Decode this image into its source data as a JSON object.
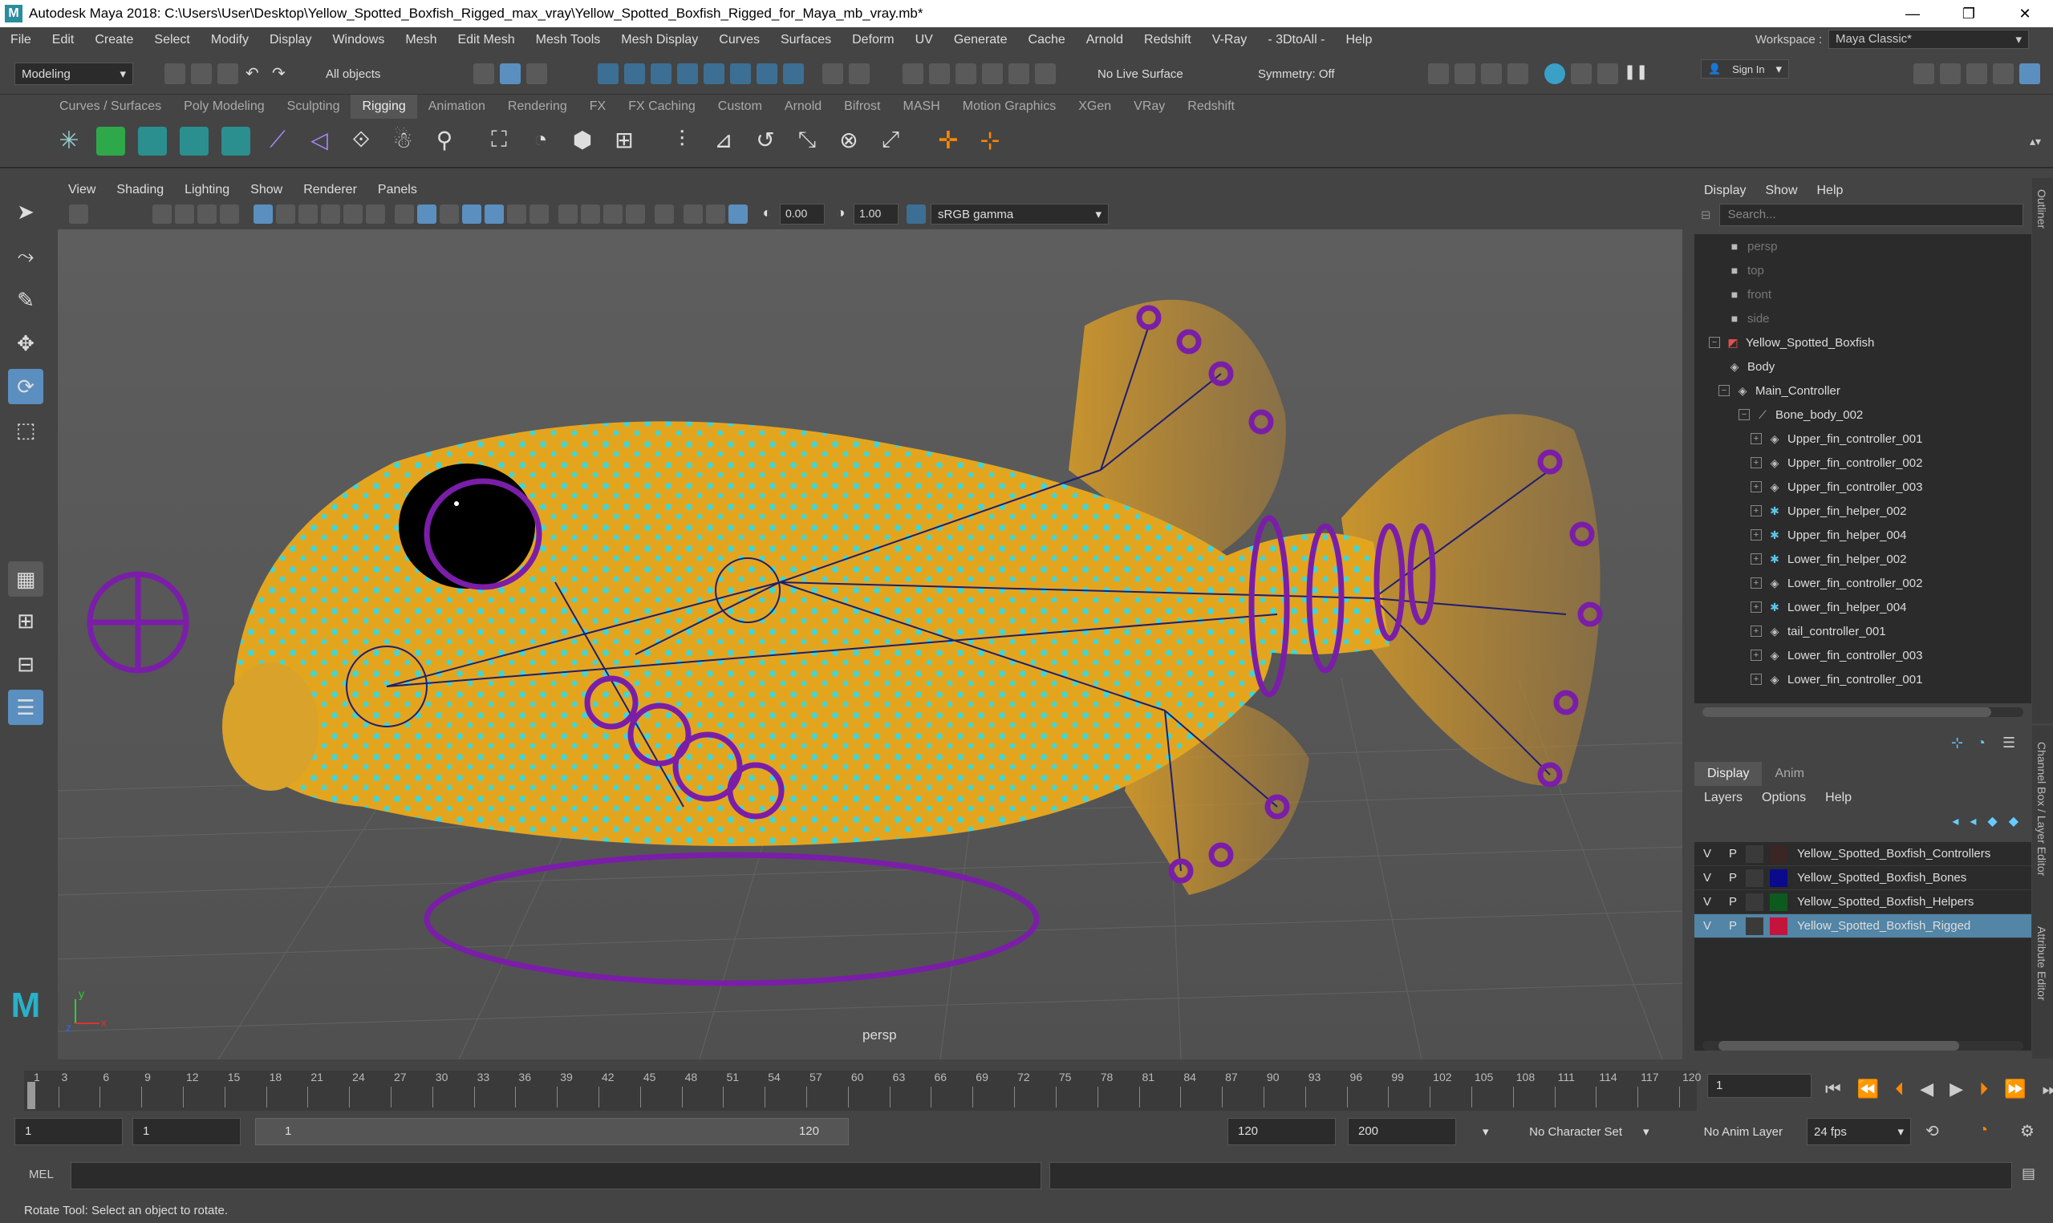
{
  "window": {
    "title": "Autodesk Maya 2018: C:\\Users\\User\\Desktop\\Yellow_Spotted_Boxfish_Rigged_max_vray\\Yellow_Spotted_Boxfish_Rigged_for_Maya_mb_vray.mb*",
    "minimize": "—",
    "maximize": "❐",
    "close": "✕"
  },
  "menubar": {
    "items": [
      "File",
      "Edit",
      "Create",
      "Select",
      "Modify",
      "Display",
      "Windows",
      "Mesh",
      "Edit Mesh",
      "Mesh Tools",
      "Mesh Display",
      "Curves",
      "Surfaces",
      "Deform",
      "UV",
      "Generate",
      "Cache",
      "Arnold",
      "Redshift",
      "V-Ray",
      "- 3DtoAll -",
      "Help"
    ],
    "workspace_label": "Workspace :",
    "workspace_value": "Maya Classic*"
  },
  "statusline": {
    "mode": "Modeling",
    "selection_mask": "All objects",
    "live_surface": "No Live Surface",
    "symmetry": "Symmetry: Off",
    "sign_in": "Sign In"
  },
  "shelf": {
    "tabs": [
      "Curves / Surfaces",
      "Poly Modeling",
      "Sculpting",
      "Rigging",
      "Animation",
      "Rendering",
      "FX",
      "FX Caching",
      "Custom",
      "Arnold",
      "Bifrost",
      "MASH",
      "Motion Graphics",
      "XGen",
      "VRay",
      "Redshift"
    ],
    "active_tab": "Rigging"
  },
  "viewport": {
    "menus": [
      "View",
      "Shading",
      "Lighting",
      "Show",
      "Renderer",
      "Panels"
    ],
    "exposure": "0.00",
    "gamma": "1.00",
    "color_space": "sRGB gamma",
    "camera_label": "persp",
    "axis_x": "x",
    "axis_y": "y",
    "axis_z": "z"
  },
  "outliner": {
    "menus": [
      "Display",
      "Show",
      "Help"
    ],
    "search_placeholder": "Search...",
    "side_label": "Outliner",
    "rows": [
      {
        "label": "persp",
        "dim": true,
        "icon": "camera-icon"
      },
      {
        "label": "top",
        "dim": true,
        "icon": "camera-icon"
      },
      {
        "label": "front",
        "dim": true,
        "icon": "camera-icon"
      },
      {
        "label": "side",
        "dim": true,
        "icon": "camera-icon"
      },
      {
        "label": "Yellow_Spotted_Boxfish",
        "icon": "mesh-icon"
      },
      {
        "label": "Body",
        "icon": "transform-icon"
      },
      {
        "label": "Main_Controller",
        "icon": "transform-icon"
      },
      {
        "label": "Bone_body_002",
        "icon": "joint-icon"
      },
      {
        "label": "Upper_fin_controller_001",
        "icon": "transform-icon"
      },
      {
        "label": "Upper_fin_controller_002",
        "icon": "transform-icon"
      },
      {
        "label": "Upper_fin_controller_003",
        "icon": "transform-icon"
      },
      {
        "label": "Upper_fin_helper_002",
        "icon": "helper-icon"
      },
      {
        "label": "Upper_fin_helper_004",
        "icon": "helper-icon"
      },
      {
        "label": "Lower_fin_helper_002",
        "icon": "helper-icon"
      },
      {
        "label": "Lower_fin_controller_002",
        "icon": "transform-icon"
      },
      {
        "label": "Lower_fin_helper_004",
        "icon": "helper-icon"
      },
      {
        "label": "tail_controller_001",
        "icon": "transform-icon"
      },
      {
        "label": "Lower_fin_controller_003",
        "icon": "transform-icon"
      },
      {
        "label": "Lower_fin_controller_001",
        "icon": "transform-icon"
      }
    ]
  },
  "layer_editor": {
    "tabs": [
      "Display",
      "Anim"
    ],
    "menus": [
      "Layers",
      "Options",
      "Help"
    ],
    "side_label_1": "Channel Box / Layer Editor",
    "side_label_2": "Attribute Editor",
    "layers": [
      {
        "v": "V",
        "p": "P",
        "color": "#3b2525",
        "name": "Yellow_Spotted_Boxfish_Controllers",
        "selected": false
      },
      {
        "v": "V",
        "p": "P",
        "color": "#0a0a8c",
        "name": "Yellow_Spotted_Boxfish_Bones",
        "selected": false
      },
      {
        "v": "V",
        "p": "P",
        "color": "#0d5a1e",
        "name": "Yellow_Spotted_Boxfish_Helpers",
        "selected": false
      },
      {
        "v": "V",
        "p": "P",
        "color": "#c4143c",
        "name": "Yellow_Spotted_Boxfish_Rigged",
        "selected": true
      }
    ]
  },
  "timeslider": {
    "ticks": [
      "1",
      "3",
      "6",
      "9",
      "12",
      "15",
      "18",
      "21",
      "24",
      "27",
      "30",
      "33",
      "36",
      "39",
      "42",
      "45",
      "48",
      "51",
      "54",
      "57",
      "60",
      "63",
      "66",
      "69",
      "72",
      "75",
      "78",
      "81",
      "84",
      "87",
      "90",
      "93",
      "96",
      "99",
      "102",
      "105",
      "108",
      "111",
      "114",
      "117",
      "120"
    ],
    "current_frame": "1"
  },
  "rangeslider": {
    "start_outer": "1",
    "start_inner": "1",
    "range_start": "1",
    "range_end": "120",
    "end_inner": "120",
    "end_outer": "200",
    "character_set": "No Character Set",
    "anim_layer": "No Anim Layer",
    "fps": "24 fps"
  },
  "cmdline": {
    "label": "MEL"
  },
  "helpline": {
    "text": "Rotate Tool: Select an object to rotate."
  },
  "colors": {
    "accent_blue": "#5285a6",
    "rig_purple": "#7a1ea8",
    "fish_yellow": "#e8a81c",
    "spot_cyan": "#3fd6d6"
  }
}
